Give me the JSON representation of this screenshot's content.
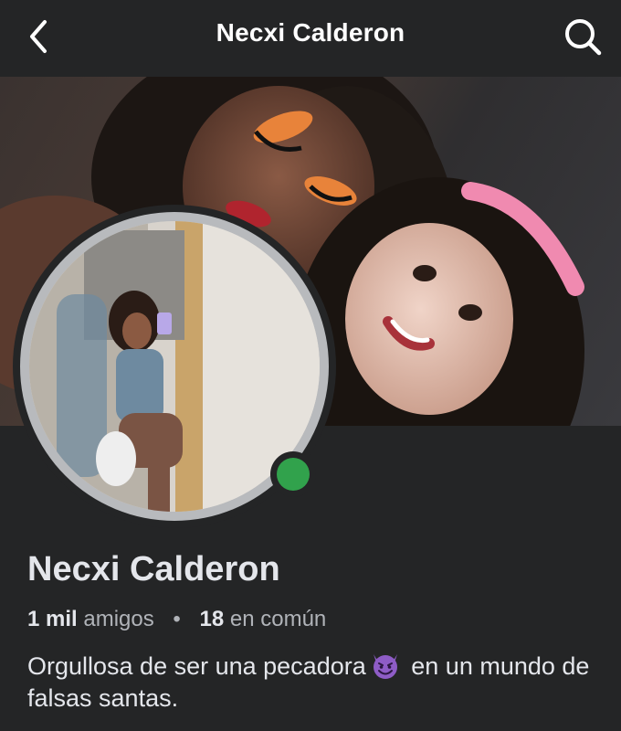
{
  "header": {
    "title": "Necxi Calderon",
    "back_icon": "chevron-left-icon",
    "search_icon": "search-icon"
  },
  "profile": {
    "name": "Necxi Calderon",
    "friends_count": "1 mil",
    "friends_label": "amigos",
    "separator": "•",
    "mutual_count": "18",
    "mutual_label": "en común",
    "bio_part1": "Orgullosa de ser una pecadora",
    "bio_emoji": "smiling-devil-emoji",
    "bio_part2": "en un mundo de falsas santas.",
    "online_status": "online"
  },
  "colors": {
    "background": "#242526",
    "text_primary": "#e4e6eb",
    "text_secondary": "#b0b3b8",
    "online": "#31a24c",
    "avatar_ring": "#b8babd"
  }
}
